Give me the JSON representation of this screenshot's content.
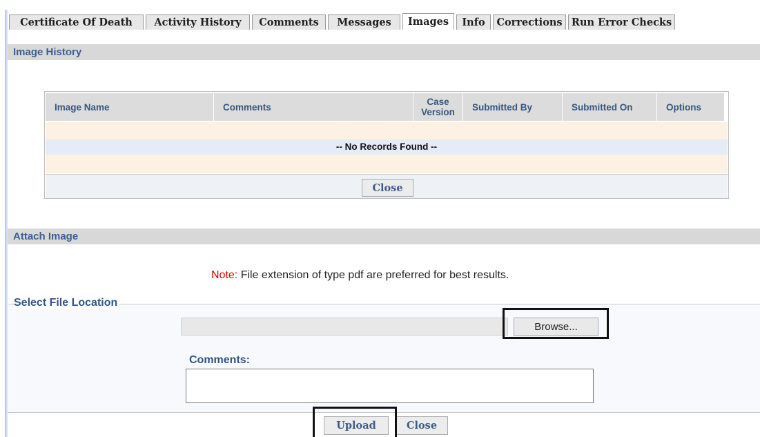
{
  "tabs": [
    {
      "label": "Certificate Of Death",
      "active": false
    },
    {
      "label": "Activity History",
      "active": false
    },
    {
      "label": "Comments",
      "active": false
    },
    {
      "label": "Messages",
      "active": false
    },
    {
      "label": "Images",
      "active": true
    },
    {
      "label": "Info",
      "active": false
    },
    {
      "label": "Corrections",
      "active": false
    },
    {
      "label": "Run Error Checks",
      "active": false
    }
  ],
  "image_history": {
    "title": "Image History",
    "columns": [
      "Image Name",
      "Comments",
      "Case Version",
      "Submitted By",
      "Submitted On",
      "Options"
    ],
    "empty_message": "-- No Records Found --",
    "close_label": "Close"
  },
  "attach_image": {
    "title": "Attach Image",
    "note_label": "Note:",
    "note_text": " File extension of type pdf are preferred for best results.",
    "file_location_legend": "Select File Location",
    "file_input_value": "",
    "browse_label": "Browse...",
    "comments_label": "Comments:",
    "comments_value": "",
    "upload_label": "Upload",
    "close_label": "Close"
  },
  "colors": {
    "section_title": "#3a5f8f",
    "note_label": "#e00000",
    "highlight_border": "#111111"
  }
}
